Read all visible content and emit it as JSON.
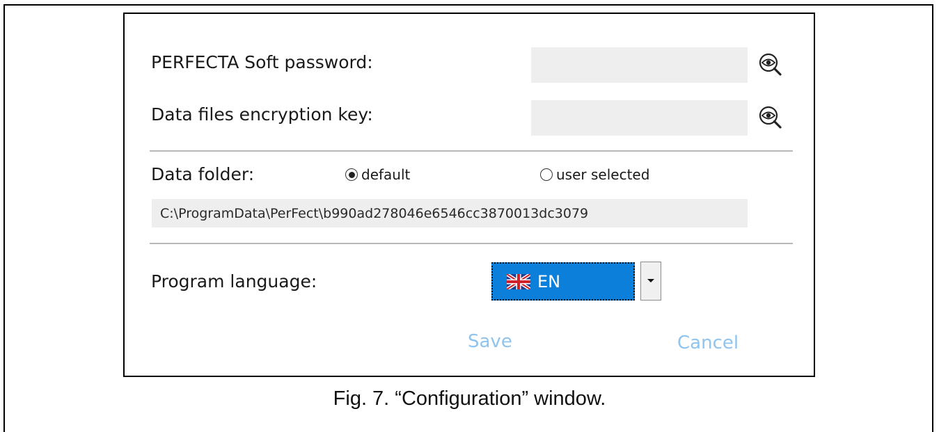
{
  "config_window": {
    "password_label": "PERFECTA Soft password:",
    "password_value": "",
    "encryption_label": "Data files encryption key:",
    "encryption_value": "",
    "data_folder_label": "Data folder:",
    "radio_default_label": "default",
    "radio_user_selected_label": "user selected",
    "selected_folder_option": "default",
    "folder_path": "C:\\ProgramData\\PerFect\\b990ad278046e6546cc3870013dc3079",
    "language_label": "Program language:",
    "language_value": "EN",
    "language_flag_icon": "uk-flag-icon",
    "save_label": "Save",
    "cancel_label": "Cancel"
  },
  "icons": {
    "show_password": "eye-magnifier-icon",
    "dropdown": "chevron-down-icon"
  },
  "colors": {
    "selected_language_bg": "#0b7fd9",
    "button_text": "#8fc4ee",
    "field_bg": "#eeeeee"
  },
  "caption": "Fig. 7. “Configuration” window."
}
